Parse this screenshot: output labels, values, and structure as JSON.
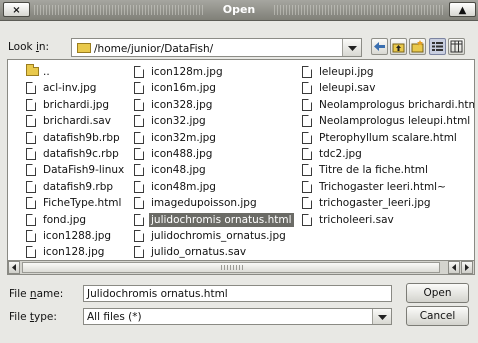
{
  "window": {
    "title": "Open",
    "close_glyph": "×",
    "maximize_glyph": "▲"
  },
  "look_in": {
    "label_pre": "Look ",
    "label_key": "i",
    "label_post": "n:",
    "path": "/home/junior/DataFish/"
  },
  "toolbar": {
    "icons": [
      "back-arrow-icon",
      "up-folder-icon",
      "new-folder-icon",
      "list-view-icon",
      "detail-view-icon"
    ]
  },
  "files": {
    "columns": [
      [
        {
          "name": "..",
          "type": "folder"
        },
        {
          "name": "acl-inv.jpg",
          "type": "file"
        },
        {
          "name": "brichardi.jpg",
          "type": "file"
        },
        {
          "name": "brichardi.sav",
          "type": "file"
        },
        {
          "name": "datafish9b.rbp",
          "type": "file"
        },
        {
          "name": "datafish9c.rbp",
          "type": "file"
        },
        {
          "name": "DataFish9-linux",
          "type": "file"
        },
        {
          "name": "datafish9.rbp",
          "type": "file"
        },
        {
          "name": "FicheType.html",
          "type": "file"
        },
        {
          "name": "fond.jpg",
          "type": "file"
        },
        {
          "name": "icon1288.jpg",
          "type": "file"
        },
        {
          "name": "icon128.jpg",
          "type": "file"
        }
      ],
      [
        {
          "name": "icon128m.jpg",
          "type": "file"
        },
        {
          "name": "icon16m.jpg",
          "type": "file"
        },
        {
          "name": "icon328.jpg",
          "type": "file"
        },
        {
          "name": "icon32.jpg",
          "type": "file"
        },
        {
          "name": "icon32m.jpg",
          "type": "file"
        },
        {
          "name": "icon488.jpg",
          "type": "file"
        },
        {
          "name": "icon48.jpg",
          "type": "file"
        },
        {
          "name": "icon48m.jpg",
          "type": "file"
        },
        {
          "name": "imagedupoisson.jpg",
          "type": "file"
        },
        {
          "name": "julidochromis ornatus.html",
          "type": "file",
          "selected": true
        },
        {
          "name": "julidochromis_ornatus.jpg",
          "type": "file"
        },
        {
          "name": "julido_ornatus.sav",
          "type": "file"
        }
      ],
      [
        {
          "name": "leleupi.jpg",
          "type": "file"
        },
        {
          "name": "leleupi.sav",
          "type": "file"
        },
        {
          "name": "Neolamprologus brichardi.htm",
          "type": "file"
        },
        {
          "name": "Neolamprologus leleupi.html",
          "type": "file"
        },
        {
          "name": "Pterophyllum scalare.html",
          "type": "file"
        },
        {
          "name": "tdc2.jpg",
          "type": "file"
        },
        {
          "name": "Titre de la fiche.html",
          "type": "file"
        },
        {
          "name": "Trichogaster leeri.html~",
          "type": "file"
        },
        {
          "name": "trichogaster_leeri.jpg",
          "type": "file"
        },
        {
          "name": "tricholeeri.sav",
          "type": "file"
        }
      ]
    ]
  },
  "file_name": {
    "label_pre": "File ",
    "label_key": "n",
    "label_post": "ame:",
    "value": "Julidochromis ornatus.html"
  },
  "file_type": {
    "label_pre": "File ",
    "label_key": "t",
    "label_post": "ype:",
    "value": "All files (*)"
  },
  "buttons": {
    "open": "Open",
    "cancel": "Cancel"
  }
}
